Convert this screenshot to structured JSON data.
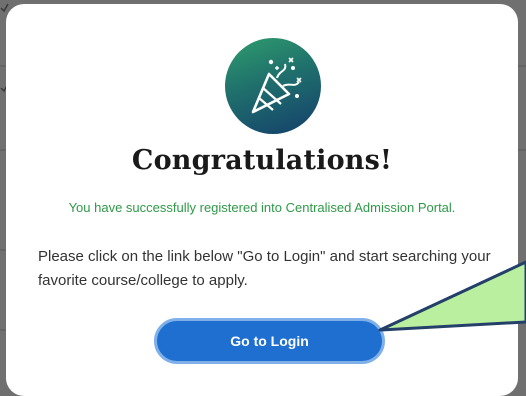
{
  "modal": {
    "title": "Congratulations!",
    "success_message": "You have successfully registered into Centralised Admission Portal.",
    "instructions": "Please click on the link below \"Go to Login\" and start searching your favorite course/college to apply.",
    "login_button_label": "Go to Login",
    "icon": "party-popper-icon"
  },
  "colors": {
    "success_text": "#2e9a48",
    "button": "#1f6fd1",
    "callout": "#b9ef9f"
  }
}
